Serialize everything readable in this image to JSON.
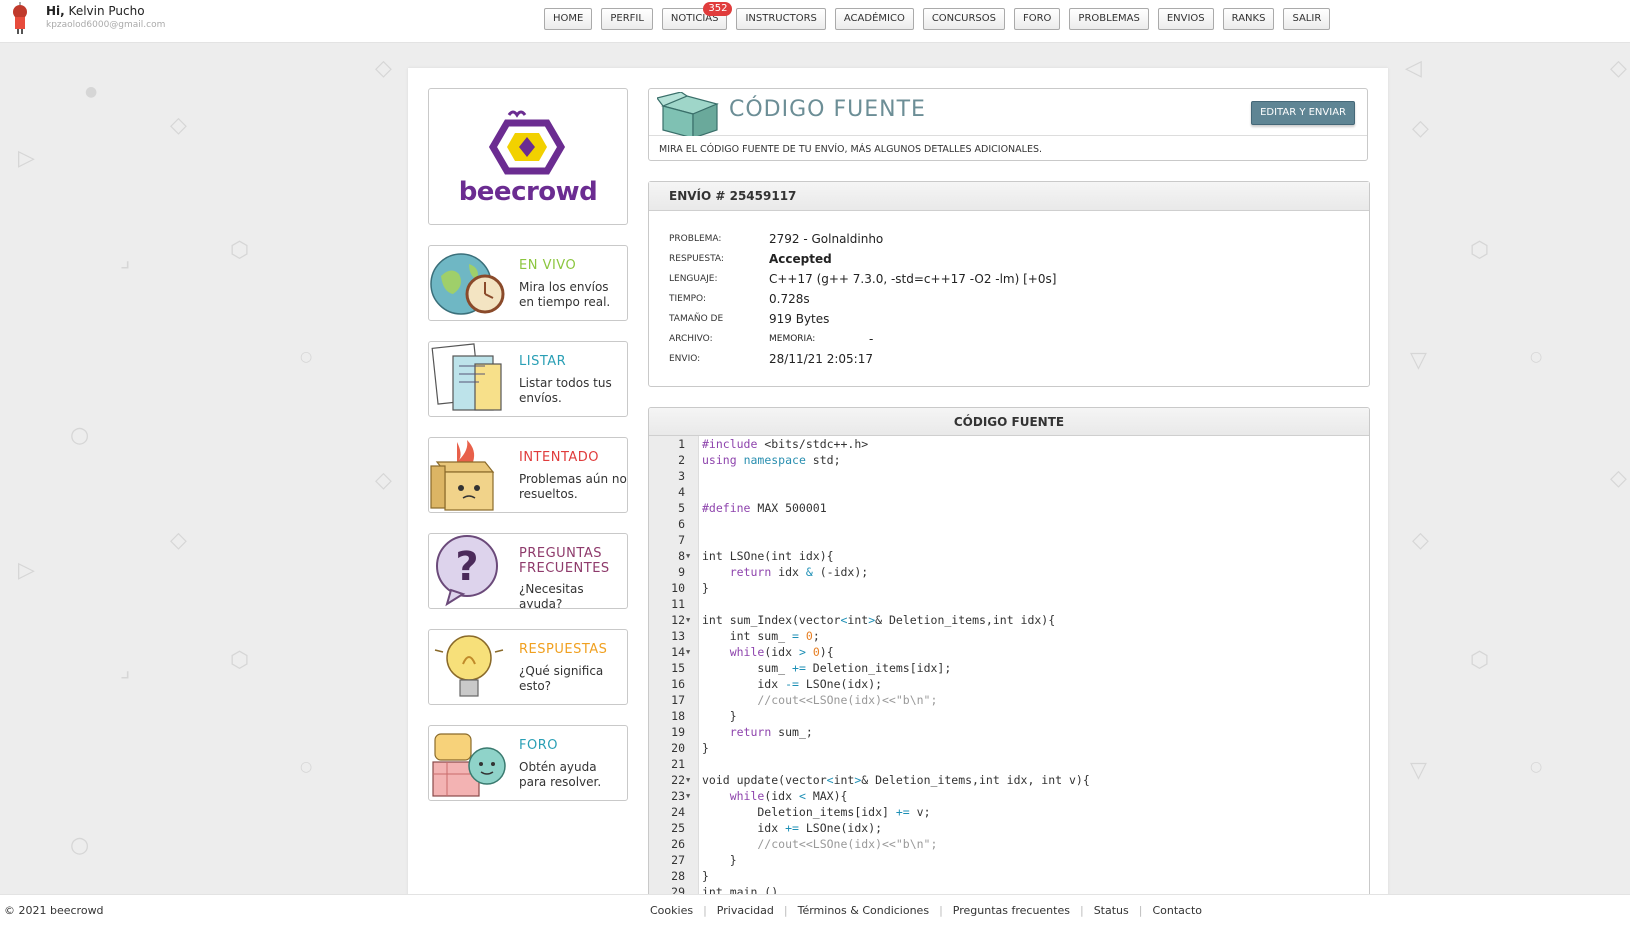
{
  "topbar": {
    "greeting_prefix": "Hi,",
    "user_name": "Kelvin Pucho",
    "user_email": "kpzaolod6000@gmail.com",
    "nav": [
      {
        "label": "HOME"
      },
      {
        "label": "PERFIL"
      },
      {
        "label": "NOTICIAS",
        "badge": "352"
      },
      {
        "label": "INSTRUCTORS"
      },
      {
        "label": "ACADÉMICO"
      },
      {
        "label": "CONCURSOS"
      },
      {
        "label": "FORO"
      },
      {
        "label": "PROBLEMAS"
      },
      {
        "label": "ENVIOS"
      },
      {
        "label": "RANKS"
      },
      {
        "label": "SALIR"
      }
    ]
  },
  "sidebar": {
    "logo_text": "beecrowd",
    "items": [
      {
        "title": "EN VIVO",
        "desc": "Mira los envíos en tiempo real.",
        "color": "#8cc63f",
        "icon": "globe-clock-icon"
      },
      {
        "title": "LISTAR",
        "desc": "Listar todos tus envíos.",
        "color": "#2a9fb5",
        "icon": "papers-icon"
      },
      {
        "title": "INTENTADO",
        "desc": "Problemas aún no resueltos.",
        "color": "#e03c3c",
        "icon": "burning-box-icon"
      },
      {
        "title": "PREGUNTAS FRECUENTES",
        "desc": "¿Necesitas ayuda?",
        "color": "#8e3a6b",
        "icon": "question-bubble-icon"
      },
      {
        "title": "RESPUESTAS",
        "desc": "¿Qué significa esto?",
        "color": "#f0a020",
        "icon": "lightbulb-icon"
      },
      {
        "title": "FORO",
        "desc": "Obtén ayuda para resolver.",
        "color": "#2a9fb5",
        "icon": "chat-bubbles-icon"
      }
    ]
  },
  "header": {
    "title": "CÓDIGO FUENTE",
    "edit_button": "EDITAR Y ENVIAR",
    "description": "MIRA EL CÓDIGO FUENTE DE TU ENVÍO, MÁS ALGUNOS DETALLES ADICIONALES."
  },
  "submission": {
    "heading": "ENVÍO # 25459117",
    "problema_label": "PROBLEMA:",
    "problema": "2792 - Golnaldinho",
    "respuesta_label": "RESPUESTA:",
    "respuesta": "Accepted",
    "lenguaje_label": "LENGUAJE:",
    "lenguaje": "C++17 (g++ 7.3.0, -std=c++17 -O2 -lm) [+0s]",
    "tiempo_label": "TIEMPO:",
    "tiempo": "0.728s",
    "tamano_label": "TAMAÑO DE",
    "tamano": "919 Bytes",
    "archivo_label": "ARCHIVO:",
    "memoria_label": "MEMORIA:",
    "memoria": "-",
    "envio_label": "ENVIO:",
    "envio": "28/11/21 2:05:17"
  },
  "code": {
    "heading": "CÓDIGO FUENTE",
    "lines": [
      "#include <bits/stdc++.h>",
      "using namespace std;",
      "",
      "",
      "#define MAX 500001",
      "",
      "",
      "int LSOne(int idx){",
      "    return idx & (-idx);",
      "}",
      "",
      "int sum_Index(vector<int>& Deletion_items,int idx){",
      "    int sum_ = 0;",
      "    while(idx > 0){",
      "        sum_ += Deletion_items[idx];",
      "        idx -= LSOne(idx);",
      "        //cout<<LSOne(idx)<<\"b\\n\";",
      "    }",
      "    return sum_;",
      "}",
      "",
      "void update(vector<int>& Deletion_items,int idx, int v){",
      "    while(idx < MAX){",
      "        Deletion_items[idx] += v;",
      "        idx += LSOne(idx);",
      "        //cout<<LSOne(idx)<<\"b\\n\";",
      "    }",
      "}",
      "int main ()"
    ],
    "folds": [
      8,
      12,
      14,
      22,
      23
    ]
  },
  "footer": {
    "copyright": "© 2021 beecrowd",
    "links": [
      "Cookies",
      "Privacidad",
      "Términos & Condiciones",
      "Preguntas frecuentes",
      "Status",
      "Contacto"
    ]
  }
}
